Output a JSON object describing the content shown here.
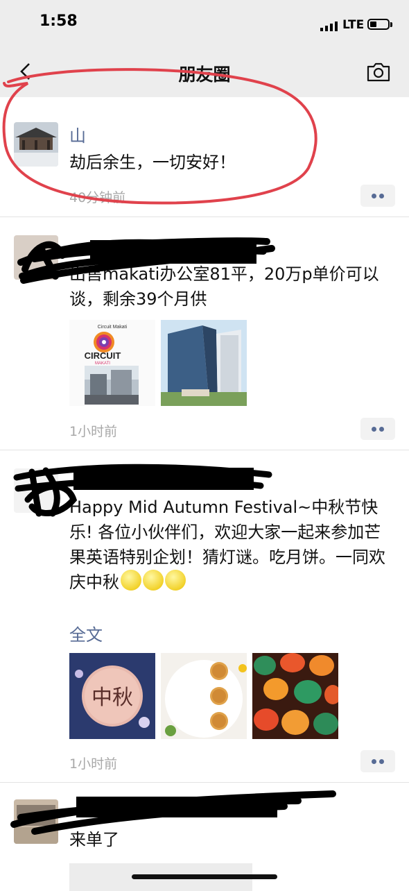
{
  "status_bar": {
    "time": "1:58",
    "network": "LTE"
  },
  "nav": {
    "title": "朋友圈",
    "back_icon": "back-arrow-icon",
    "camera_icon": "camera-icon"
  },
  "posts": [
    {
      "name": "山",
      "content": "劫后余生，一切安好！",
      "time": "40分钟前"
    },
    {
      "name": "",
      "content": "出售makati办公室81平，20万p单价可以谈，剩余39个月供",
      "time": "1小时前",
      "images": [
        {
          "caption": "Circuit Makati",
          "logo": "CIRCUIT",
          "sublogo": "MAKATI"
        },
        {
          "caption": ""
        }
      ]
    },
    {
      "name": "",
      "content": "Happy Mid Autumn Festival~中秋节快乐! 各位小伙伴们，欢迎大家一起来参加芒果英语特别企划！猜灯谜。吃月饼。一同欢庆中秋",
      "time": "1小时前",
      "full_text": "全文",
      "images": [
        {
          "caption": "中秋"
        },
        {
          "caption": ""
        },
        {
          "caption": ""
        }
      ]
    },
    {
      "name": "",
      "content": "来单了",
      "time": ""
    }
  ],
  "colors": {
    "link": "#576b95",
    "annotation": "#e0424c",
    "nav_bg": "#ededed"
  }
}
